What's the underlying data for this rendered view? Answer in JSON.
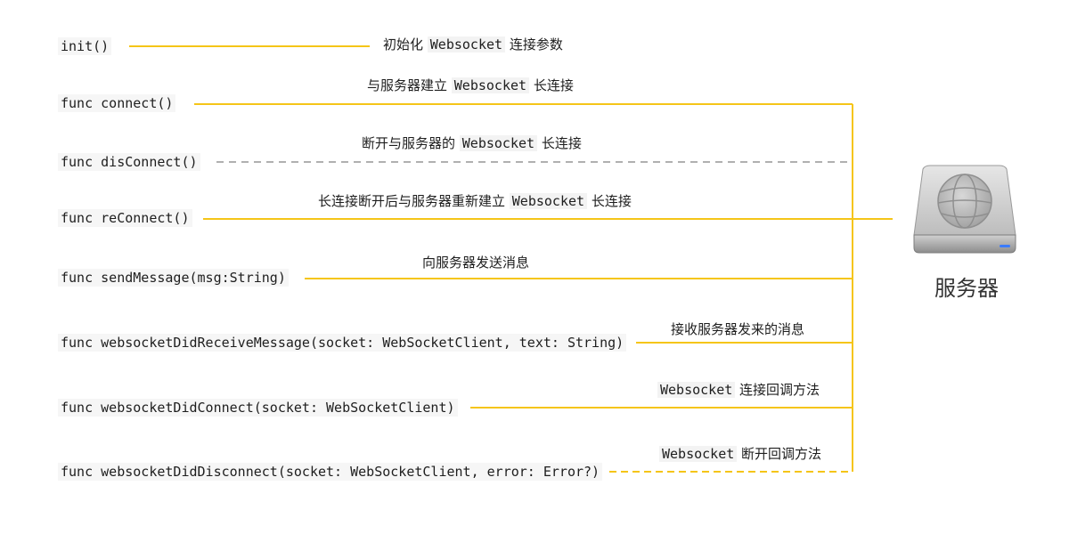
{
  "methods": [
    {
      "keyword": "",
      "signature": "init()"
    },
    {
      "keyword": "func",
      "signature": "connect()"
    },
    {
      "keyword": "func",
      "signature": "disConnect()"
    },
    {
      "keyword": "func",
      "signature": "reConnect()"
    },
    {
      "keyword": "func",
      "signature": "sendMessage(msg:String)"
    },
    {
      "keyword": "func",
      "signature": "websocketDidReceiveMessage(socket: WebSocketClient, text: String)"
    },
    {
      "keyword": "func",
      "signature": "websocketDidConnect(socket: WebSocketClient)"
    },
    {
      "keyword": "func",
      "signature": "websocketDidDisconnect(socket: WebSocketClient, error: Error?)"
    }
  ],
  "notes": [
    {
      "before": "初始化 ",
      "code": "Websocket",
      "after": " 连接参数"
    },
    {
      "before": "与服务器建立 ",
      "code": "Websocket",
      "after": " 长连接"
    },
    {
      "before": "断开与服务器的 ",
      "code": "Websocket",
      "after": " 长连接"
    },
    {
      "before": "长连接断开后与服务器重新建立 ",
      "code": "Websocket",
      "after": " 长连接"
    },
    {
      "before": "向服务器发送消息",
      "code": "",
      "after": ""
    },
    {
      "before": "接收服务器发来的消息",
      "code": "",
      "after": ""
    },
    {
      "before": "",
      "code": "Websocket",
      "after": " 连接回调方法"
    },
    {
      "before": "",
      "code": "Websocket",
      "after": " 断开回调方法"
    }
  ],
  "server": {
    "label": "服务器",
    "icon": "server-drive-icon"
  },
  "colors": {
    "line": "#f5c518",
    "dashed": "#b0b0b0",
    "text": "#1e1e1e"
  }
}
